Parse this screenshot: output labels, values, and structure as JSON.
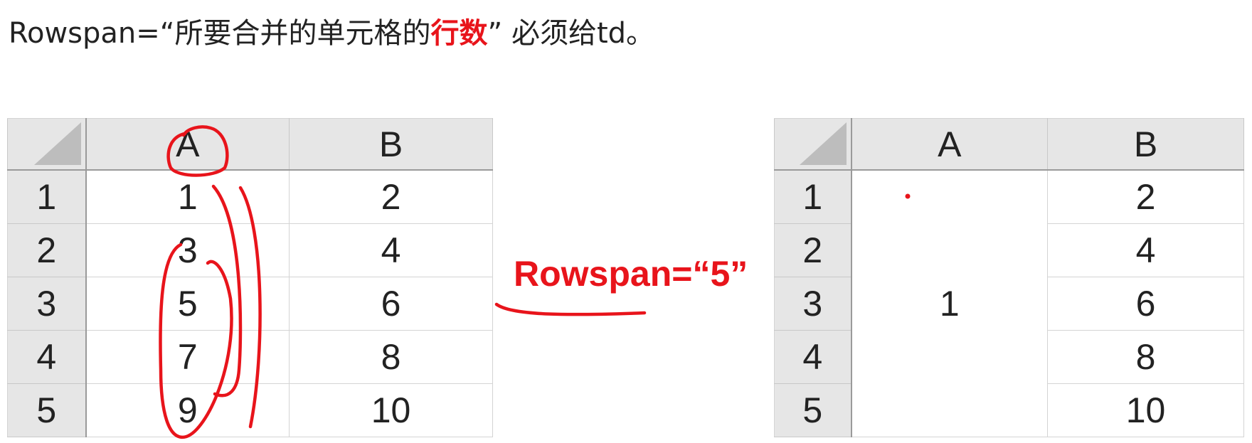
{
  "title": {
    "prefix": "Rowspan=“所要合并的单元格的",
    "emphasis": "行数",
    "suffix": "” 必须给td。"
  },
  "middle_label": "Rowspan=“5”",
  "left_table": {
    "headers": [
      "A",
      "B"
    ],
    "rows": [
      {
        "num": "1",
        "a": "1",
        "b": "2"
      },
      {
        "num": "2",
        "a": "3",
        "b": "4"
      },
      {
        "num": "3",
        "a": "5",
        "b": "6"
      },
      {
        "num": "4",
        "a": "7",
        "b": "8"
      },
      {
        "num": "5",
        "a": "9",
        "b": "10"
      }
    ]
  },
  "right_table": {
    "headers": [
      "A",
      "B"
    ],
    "merged_a": "1",
    "rows": [
      {
        "num": "1",
        "b": "2"
      },
      {
        "num": "2",
        "b": "4"
      },
      {
        "num": "3",
        "b": "6"
      },
      {
        "num": "4",
        "b": "8"
      },
      {
        "num": "5",
        "b": "10"
      }
    ]
  },
  "colors": {
    "accent_red": "#e8141b",
    "header_gray": "#e6e6e6",
    "text": "#222222"
  }
}
